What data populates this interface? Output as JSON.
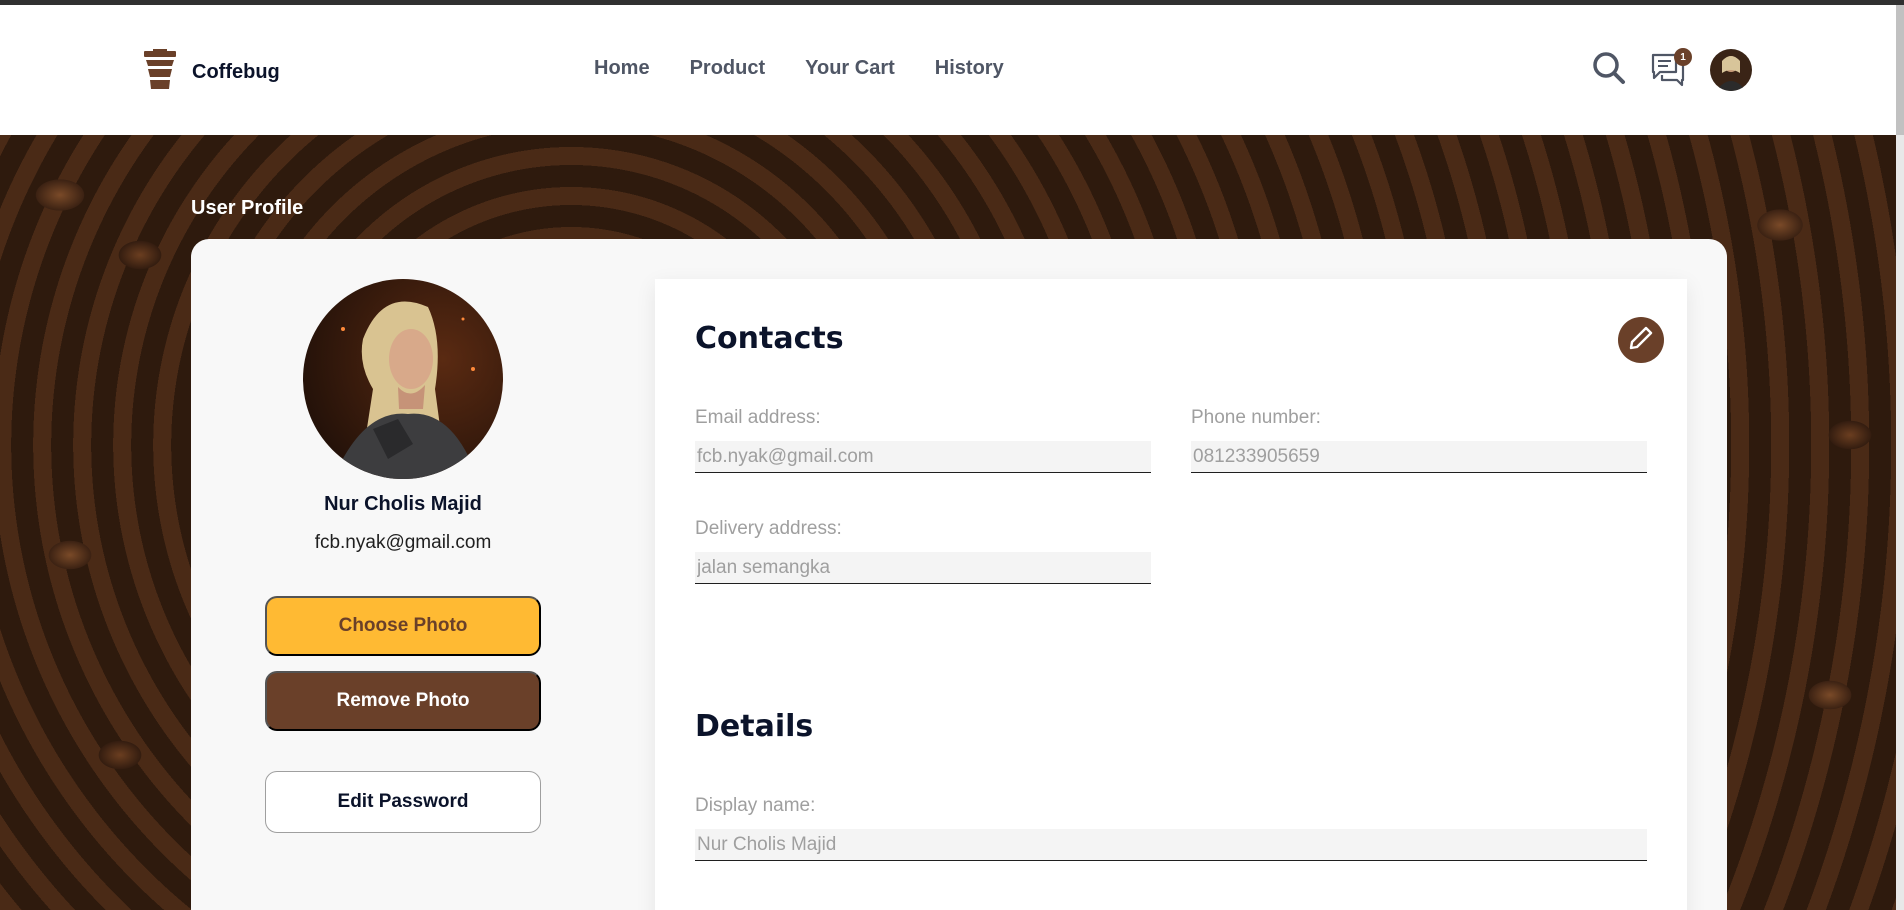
{
  "brand": {
    "name": "Coffebug"
  },
  "nav": {
    "links": [
      {
        "label": "Home"
      },
      {
        "label": "Product"
      },
      {
        "label": "Your Cart"
      },
      {
        "label": "History"
      }
    ],
    "chat_badge": "1"
  },
  "page": {
    "title": "User Profile"
  },
  "profile": {
    "name": "Nur Cholis Majid",
    "email": "fcb.nyak@gmail.com",
    "choose_photo": "Choose Photo",
    "remove_photo": "Remove Photo",
    "edit_password": "Edit Password"
  },
  "contacts": {
    "title": "Contacts",
    "email_label": "Email address:",
    "email_value": "fcb.nyak@gmail.com",
    "phone_label": "Phone number:",
    "phone_value": "081233905659",
    "address_label": "Delivery address:",
    "address_value": "jalan semangka"
  },
  "details": {
    "title": "Details",
    "display_name_label": "Display name:",
    "display_name_value": "Nur Cholis Majid"
  },
  "colors": {
    "primary_brown": "#6a4029",
    "accent_yellow": "#ffba33",
    "nav_text": "#4f5665"
  }
}
